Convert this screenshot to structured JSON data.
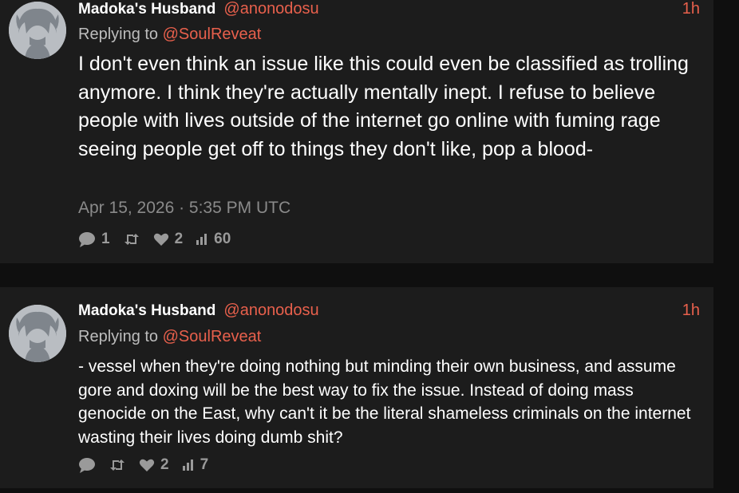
{
  "posts": [
    {
      "author": {
        "display_name": "Madoka's Husband",
        "handle": "@anonodosu"
      },
      "time": "1h",
      "replying_prefix": "Replying to",
      "replying_to": "@SoulReveat",
      "text": "I don't even think an issue like this could even be classified as trolling anymore. I think they're actually mentally inept. I refuse to believe people with lives outside of the internet go online with fuming rage seeing people get off to things they don't like, pop a blood-",
      "date": "Apr 15, 2026 · 5:35 PM UTC",
      "stats": {
        "replies": "1",
        "retweets": "",
        "likes": "2",
        "views": "60"
      }
    },
    {
      "author": {
        "display_name": "Madoka's Husband",
        "handle": "@anonodosu"
      },
      "time": "1h",
      "replying_prefix": "Replying to",
      "replying_to": "@SoulReveat",
      "text": "- vessel when they're doing nothing but minding their own business, and assume gore and doxing will be the best way to fix the issue. Instead of doing mass genocide on the East, why can't it be the literal shameless criminals on the internet wasting their lives doing dumb shit?",
      "stats": {
        "replies": "",
        "retweets": "",
        "likes": "2",
        "views": "7"
      }
    }
  ],
  "icons": {
    "avatar": "anime-avatar-icon",
    "reply": "comment-icon",
    "retweet": "retweet-icon",
    "like": "heart-icon",
    "views": "bar-chart-icon"
  },
  "colors": {
    "background": "#0f0f0f",
    "card": "#1c1c1c",
    "accent": "#e8604c",
    "text": "#ffffff",
    "muted": "#8a8a8a"
  }
}
